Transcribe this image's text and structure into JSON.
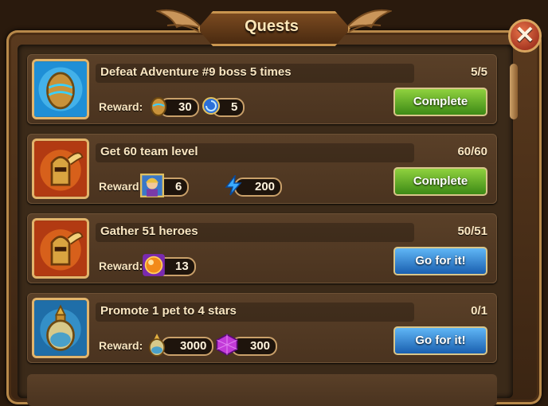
{
  "window": {
    "title": "Quests",
    "close_label": "✕"
  },
  "reward_label": "Reward:",
  "quests": [
    {
      "title": "Defeat Adventure #9 boss 5 times",
      "progress": "5/5",
      "button": "Complete",
      "rewards": [
        {
          "icon": "bronze-egg-icon",
          "amount": "30"
        },
        {
          "icon": "swirl-orb-icon",
          "amount": "5"
        }
      ]
    },
    {
      "title": "Get 60 team level",
      "progress": "60/60",
      "button": "Complete",
      "rewards": [
        {
          "icon": "hero-portrait-icon",
          "amount": "6"
        },
        {
          "icon": "lightning-icon",
          "amount": "200"
        }
      ]
    },
    {
      "title": "Gather 51 heroes",
      "progress": "50/51",
      "button": "Go for it!",
      "rewards": [
        {
          "icon": "fire-orb-icon",
          "amount": "13"
        }
      ]
    },
    {
      "title": "Promote 1 pet to 4 stars",
      "progress": "0/1",
      "button": "Go for it!",
      "rewards": [
        {
          "icon": "pet-potion-icon",
          "amount": "3000"
        },
        {
          "icon": "purple-gem-icon",
          "amount": "300"
        }
      ]
    }
  ],
  "colors": {
    "complete": "#5aa728",
    "go": "#2a7fd4",
    "text": "#fbe7c2"
  }
}
